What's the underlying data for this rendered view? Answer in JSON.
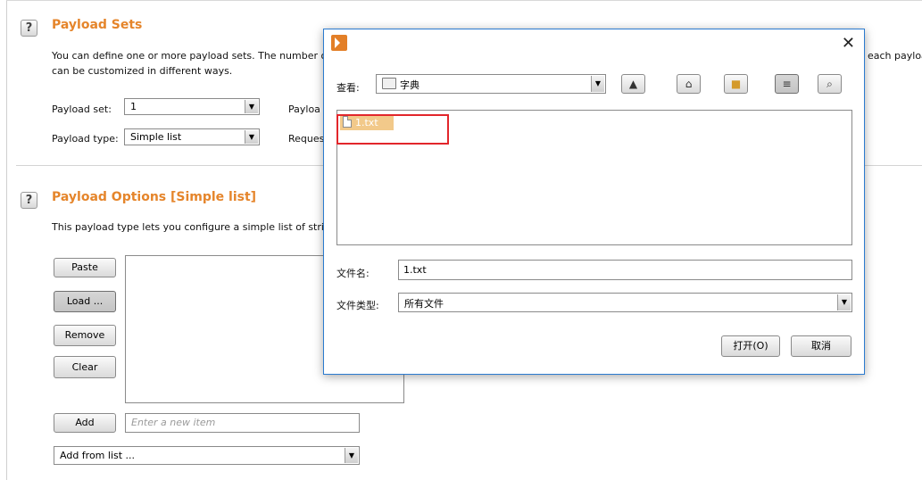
{
  "payload_sets": {
    "title": "Payload Sets",
    "desc_line1": "You can define one or more payload sets. The number o",
    "desc_line1_tail": "each payloa",
    "desc_line2": "can be customized in different ways.",
    "payload_set_label": "Payload set:",
    "payload_set_value": "1",
    "payload_type_label": "Payload type:",
    "payload_type_value": "Simple list",
    "payload_count_label": "Payloa",
    "request_count_label": "Reques"
  },
  "payload_options": {
    "title": "Payload Options [Simple list]",
    "desc": "This payload type lets you configure a simple list of strin",
    "buttons": {
      "paste": "Paste",
      "load": "Load ...",
      "remove": "Remove",
      "clear": "Clear",
      "add": "Add"
    },
    "new_item_placeholder": "Enter a new item",
    "add_from_list": "Add from list ..."
  },
  "dialog": {
    "look_in_label": "查看:",
    "look_in_value": "字典",
    "toolbar_icons": [
      "up-folder-icon",
      "home-icon",
      "new-folder-icon",
      "list-view-icon",
      "details-view-icon"
    ],
    "files": [
      {
        "name": "1.txt",
        "selected": true
      }
    ],
    "filename_label": "文件名:",
    "filename_value": "1.txt",
    "filetype_label": "文件类型:",
    "filetype_value": "所有文件",
    "open_button": "打开(O)",
    "cancel_button": "取消"
  },
  "colors": {
    "section_title": "#e5852b",
    "selection_highlight": "#f2c98a",
    "annotation_box": "#e2262b",
    "dialog_border": "#2b7bd0"
  }
}
